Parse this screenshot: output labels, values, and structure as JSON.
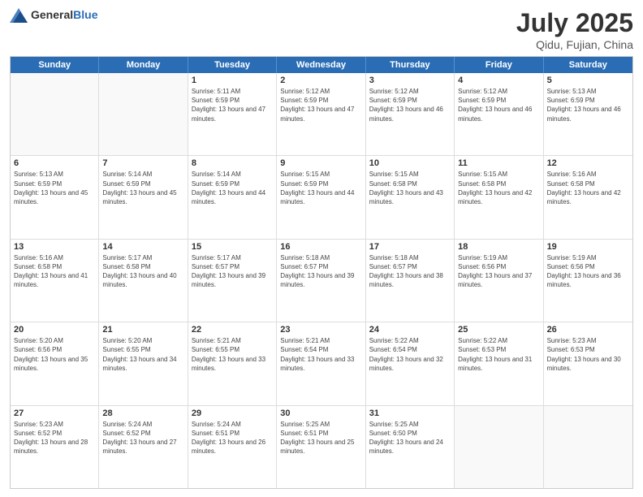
{
  "header": {
    "logo_general": "General",
    "logo_blue": "Blue",
    "title": "July 2025",
    "subtitle": "Qidu, Fujian, China"
  },
  "days_of_week": [
    "Sunday",
    "Monday",
    "Tuesday",
    "Wednesday",
    "Thursday",
    "Friday",
    "Saturday"
  ],
  "weeks": [
    [
      {
        "day": "",
        "info": ""
      },
      {
        "day": "",
        "info": ""
      },
      {
        "day": "1",
        "info": "Sunrise: 5:11 AM\nSunset: 6:59 PM\nDaylight: 13 hours and 47 minutes."
      },
      {
        "day": "2",
        "info": "Sunrise: 5:12 AM\nSunset: 6:59 PM\nDaylight: 13 hours and 47 minutes."
      },
      {
        "day": "3",
        "info": "Sunrise: 5:12 AM\nSunset: 6:59 PM\nDaylight: 13 hours and 46 minutes."
      },
      {
        "day": "4",
        "info": "Sunrise: 5:12 AM\nSunset: 6:59 PM\nDaylight: 13 hours and 46 minutes."
      },
      {
        "day": "5",
        "info": "Sunrise: 5:13 AM\nSunset: 6:59 PM\nDaylight: 13 hours and 46 minutes."
      }
    ],
    [
      {
        "day": "6",
        "info": "Sunrise: 5:13 AM\nSunset: 6:59 PM\nDaylight: 13 hours and 45 minutes."
      },
      {
        "day": "7",
        "info": "Sunrise: 5:14 AM\nSunset: 6:59 PM\nDaylight: 13 hours and 45 minutes."
      },
      {
        "day": "8",
        "info": "Sunrise: 5:14 AM\nSunset: 6:59 PM\nDaylight: 13 hours and 44 minutes."
      },
      {
        "day": "9",
        "info": "Sunrise: 5:15 AM\nSunset: 6:59 PM\nDaylight: 13 hours and 44 minutes."
      },
      {
        "day": "10",
        "info": "Sunrise: 5:15 AM\nSunset: 6:58 PM\nDaylight: 13 hours and 43 minutes."
      },
      {
        "day": "11",
        "info": "Sunrise: 5:15 AM\nSunset: 6:58 PM\nDaylight: 13 hours and 42 minutes."
      },
      {
        "day": "12",
        "info": "Sunrise: 5:16 AM\nSunset: 6:58 PM\nDaylight: 13 hours and 42 minutes."
      }
    ],
    [
      {
        "day": "13",
        "info": "Sunrise: 5:16 AM\nSunset: 6:58 PM\nDaylight: 13 hours and 41 minutes."
      },
      {
        "day": "14",
        "info": "Sunrise: 5:17 AM\nSunset: 6:58 PM\nDaylight: 13 hours and 40 minutes."
      },
      {
        "day": "15",
        "info": "Sunrise: 5:17 AM\nSunset: 6:57 PM\nDaylight: 13 hours and 39 minutes."
      },
      {
        "day": "16",
        "info": "Sunrise: 5:18 AM\nSunset: 6:57 PM\nDaylight: 13 hours and 39 minutes."
      },
      {
        "day": "17",
        "info": "Sunrise: 5:18 AM\nSunset: 6:57 PM\nDaylight: 13 hours and 38 minutes."
      },
      {
        "day": "18",
        "info": "Sunrise: 5:19 AM\nSunset: 6:56 PM\nDaylight: 13 hours and 37 minutes."
      },
      {
        "day": "19",
        "info": "Sunrise: 5:19 AM\nSunset: 6:56 PM\nDaylight: 13 hours and 36 minutes."
      }
    ],
    [
      {
        "day": "20",
        "info": "Sunrise: 5:20 AM\nSunset: 6:56 PM\nDaylight: 13 hours and 35 minutes."
      },
      {
        "day": "21",
        "info": "Sunrise: 5:20 AM\nSunset: 6:55 PM\nDaylight: 13 hours and 34 minutes."
      },
      {
        "day": "22",
        "info": "Sunrise: 5:21 AM\nSunset: 6:55 PM\nDaylight: 13 hours and 33 minutes."
      },
      {
        "day": "23",
        "info": "Sunrise: 5:21 AM\nSunset: 6:54 PM\nDaylight: 13 hours and 33 minutes."
      },
      {
        "day": "24",
        "info": "Sunrise: 5:22 AM\nSunset: 6:54 PM\nDaylight: 13 hours and 32 minutes."
      },
      {
        "day": "25",
        "info": "Sunrise: 5:22 AM\nSunset: 6:53 PM\nDaylight: 13 hours and 31 minutes."
      },
      {
        "day": "26",
        "info": "Sunrise: 5:23 AM\nSunset: 6:53 PM\nDaylight: 13 hours and 30 minutes."
      }
    ],
    [
      {
        "day": "27",
        "info": "Sunrise: 5:23 AM\nSunset: 6:52 PM\nDaylight: 13 hours and 28 minutes."
      },
      {
        "day": "28",
        "info": "Sunrise: 5:24 AM\nSunset: 6:52 PM\nDaylight: 13 hours and 27 minutes."
      },
      {
        "day": "29",
        "info": "Sunrise: 5:24 AM\nSunset: 6:51 PM\nDaylight: 13 hours and 26 minutes."
      },
      {
        "day": "30",
        "info": "Sunrise: 5:25 AM\nSunset: 6:51 PM\nDaylight: 13 hours and 25 minutes."
      },
      {
        "day": "31",
        "info": "Sunrise: 5:25 AM\nSunset: 6:50 PM\nDaylight: 13 hours and 24 minutes."
      },
      {
        "day": "",
        "info": ""
      },
      {
        "day": "",
        "info": ""
      }
    ]
  ]
}
